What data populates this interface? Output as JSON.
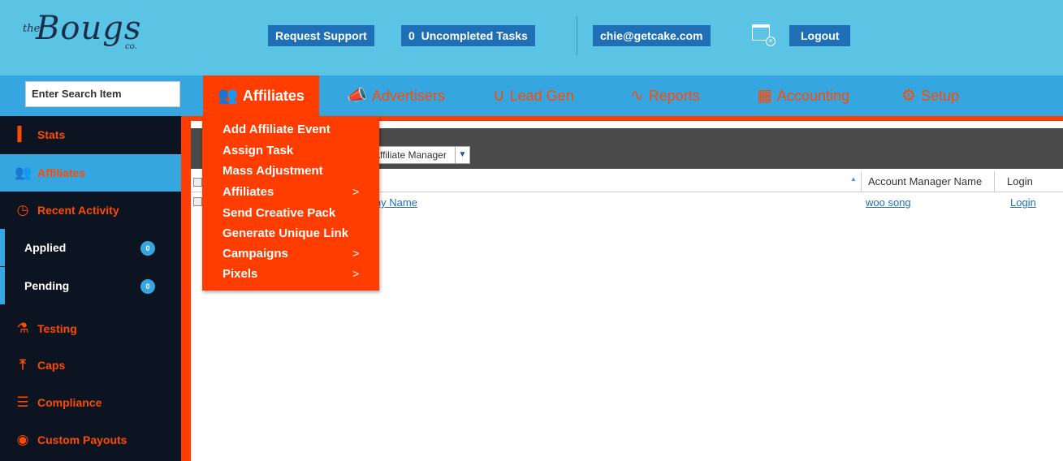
{
  "logo": {
    "brand_name": "Bougs",
    "the": "the",
    "co": "co."
  },
  "topbar": {
    "request_support": "Request Support",
    "tasks_count": "0",
    "tasks_label": "Uncompleted Tasks",
    "email": "chie@getcake.com",
    "logout": "Logout"
  },
  "search": {
    "placeholder": "Enter Search Item"
  },
  "nav": [
    {
      "label": "Affiliates",
      "icon": "people-icon",
      "active": true
    },
    {
      "label": "Advertisers",
      "icon": "megaphone-icon"
    },
    {
      "label": "Lead Gen",
      "icon": "magnet-icon"
    },
    {
      "label": "Reports",
      "icon": "chart-line-icon"
    },
    {
      "label": "Accounting",
      "icon": "calculator-icon"
    },
    {
      "label": "Setup",
      "icon": "gears-icon"
    }
  ],
  "sidebar": [
    {
      "label": "Stats",
      "icon": "bar-chart-icon"
    },
    {
      "label": "Affiliates",
      "icon": "people-icon",
      "active": true
    },
    {
      "label": "Recent Activity",
      "icon": "clock-icon"
    },
    {
      "label": "Applied",
      "badge": "0"
    },
    {
      "label": "Pending",
      "badge": "0"
    },
    {
      "label": "Testing",
      "icon": "flask-icon"
    },
    {
      "label": "Caps",
      "icon": "cap-arrow-icon"
    },
    {
      "label": "Compliance",
      "icon": "checklist-icon"
    },
    {
      "label": "Custom Payouts",
      "icon": "money-bag-icon"
    }
  ],
  "filter": {
    "selected": "Affiliate Manager"
  },
  "table": {
    "columns": [
      "Account Manager Name",
      "Login"
    ],
    "rows": [
      {
        "company": "Company Name",
        "manager": "woo song",
        "login": "Login"
      }
    ]
  },
  "dropdown": [
    {
      "label": "Add Affiliate Event"
    },
    {
      "label": "Assign Task"
    },
    {
      "label": "Mass Adjustment"
    },
    {
      "label": "Affiliates",
      "submenu": true
    },
    {
      "label": "Send Creative Pack"
    },
    {
      "label": "Generate Unique Link"
    },
    {
      "label": "Campaigns",
      "submenu": true
    },
    {
      "label": "Pixels",
      "submenu": true
    }
  ],
  "colors": {
    "accent": "#ff3d00",
    "topbar": "#5bc4e4",
    "navbar": "#36a6e0",
    "sidebar": "#0b1420",
    "button": "#1e6fb5"
  }
}
